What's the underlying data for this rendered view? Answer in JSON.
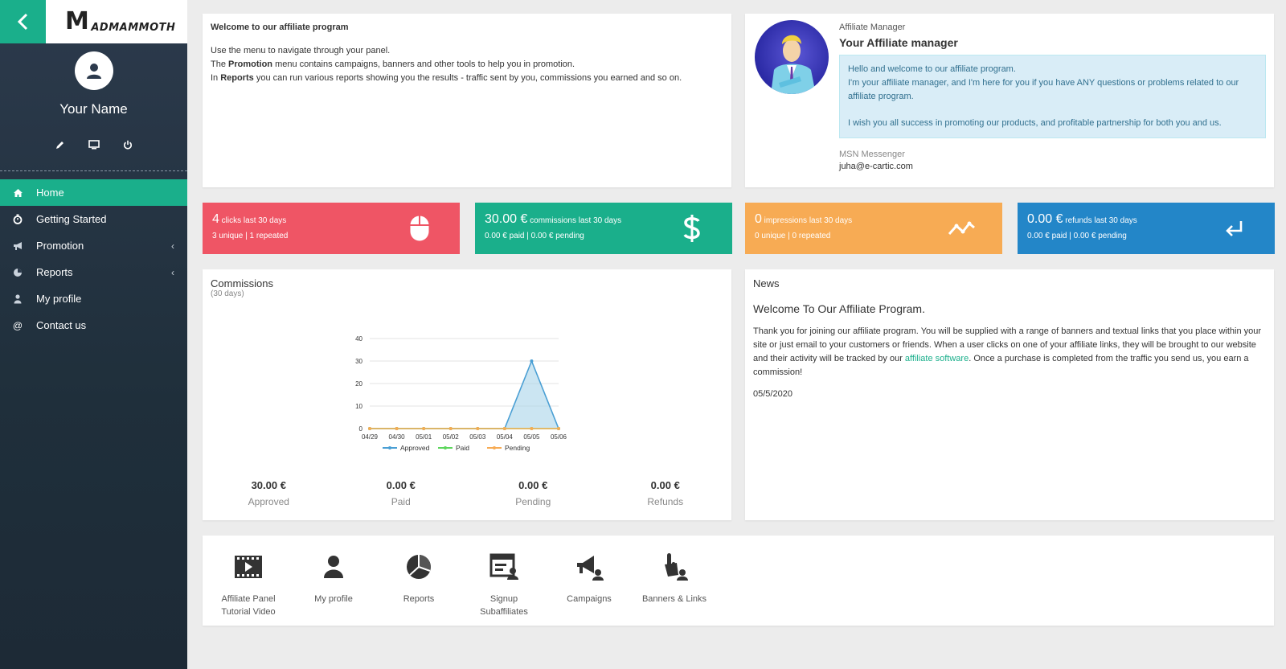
{
  "sidebar": {
    "logo_text": "ADMAMMOTH",
    "user_name": "Your Name",
    "nav": [
      {
        "label": "Home",
        "icon": "home-icon"
      },
      {
        "label": "Getting Started",
        "icon": "stopwatch-icon"
      },
      {
        "label": "Promotion",
        "icon": "bullhorn-icon"
      },
      {
        "label": "Reports",
        "icon": "pie-chart-icon"
      },
      {
        "label": "My profile",
        "icon": "user-icon"
      },
      {
        "label": "Contact us",
        "icon": "at-icon"
      }
    ],
    "at_glyph": "@"
  },
  "welcome": {
    "title": "Welcome to our affiliate program",
    "line1": "Use the menu to navigate through your panel.",
    "line2_a": "The ",
    "line2_b": "Promotion",
    "line2_c": " menu contains campaigns, banners and other tools to help you in promotion.",
    "line3_a": "In ",
    "line3_b": "Reports",
    "line3_c": " you can run various reports showing you the results - traffic sent by you, commissions you earned and so on."
  },
  "manager": {
    "label": "Affiliate Manager",
    "title": "Your Affiliate manager",
    "msg1": "Hello and welcome to our affiliate program.",
    "msg2": "I'm your affiliate manager, and I'm here for you if you have ANY questions or problems related to our affiliate program.",
    "msg3": "I wish you all success in promoting our products, and profitable partnership for both you and us.",
    "msn_label": "MSN Messenger",
    "email": "juha@e-cartic.com"
  },
  "stats": [
    {
      "big": "4",
      "small": " clicks last 30 days",
      "line2": "3 unique | 1 repeated",
      "icon": "mouse-icon",
      "color": "#ef5565"
    },
    {
      "big": "30.00 €",
      "small": " commissions last 30 days",
      "line2": "0.00 € paid | 0.00 € pending",
      "icon": "dollar-icon",
      "color": "#1aaf8b"
    },
    {
      "big": "0",
      "small": " impressions last 30 days",
      "line2": "0 unique | 0 repeated",
      "icon": "trend-icon",
      "color": "#f7ab54"
    },
    {
      "big": "0.00 €",
      "small": " refunds last 30 days",
      "line2": "0.00 € paid | 0.00 € pending",
      "icon": "return-icon",
      "color": "#2386c8"
    }
  ],
  "commissions": {
    "title": "Commissions",
    "subtitle": "(30 days)",
    "totals": [
      {
        "value": "30.00 €",
        "label": "Approved"
      },
      {
        "value": "0.00 €",
        "label": "Paid"
      },
      {
        "value": "0.00 €",
        "label": "Pending"
      },
      {
        "value": "0.00 €",
        "label": "Refunds"
      }
    ]
  },
  "chart_data": {
    "type": "area",
    "categories": [
      "04/29",
      "04/30",
      "05/01",
      "05/02",
      "05/03",
      "05/04",
      "05/05",
      "05/06"
    ],
    "series": [
      {
        "name": "Approved",
        "values": [
          0,
          0,
          0,
          0,
          0,
          0,
          30,
          0
        ],
        "color": "#4a9fd4"
      },
      {
        "name": "Paid",
        "values": [
          0,
          0,
          0,
          0,
          0,
          0,
          0,
          0
        ],
        "color": "#5cd65c"
      },
      {
        "name": "Pending",
        "values": [
          0,
          0,
          0,
          0,
          0,
          0,
          0,
          0
        ],
        "color": "#f7ab54"
      }
    ],
    "yticks": [
      0,
      10,
      20,
      30,
      40
    ],
    "ylim": [
      0,
      40
    ],
    "legend": "bottom",
    "grid": true
  },
  "news": {
    "header": "News",
    "title": "Welcome To Our Affiliate Program.",
    "body_a": "Thank you for joining our affiliate program. You will be supplied with a range of banners and textual links that you place within your site or just email to your customers or friends. When a user clicks on one of your affiliate links, they will be brought to our website and their activity will be tracked by our ",
    "link": "affiliate software",
    "body_b": ". Once a purchase is completed from the traffic you send us, you earn a commission!",
    "date": "05/5/2020"
  },
  "shortcuts": [
    {
      "line1": "Affiliate Panel",
      "line2": "Tutorial Video",
      "icon": "video-icon"
    },
    {
      "line1": "My profile",
      "line2": "",
      "icon": "user-icon"
    },
    {
      "line1": "Reports",
      "line2": "",
      "icon": "pie-chart-icon"
    },
    {
      "line1": "Signup",
      "line2": "Subaffiliates",
      "icon": "signup-icon"
    },
    {
      "line1": "Campaigns",
      "line2": "",
      "icon": "megaphone-icon"
    },
    {
      "line1": "Banners & Links",
      "line2": "",
      "icon": "hand-pointer-icon"
    }
  ]
}
